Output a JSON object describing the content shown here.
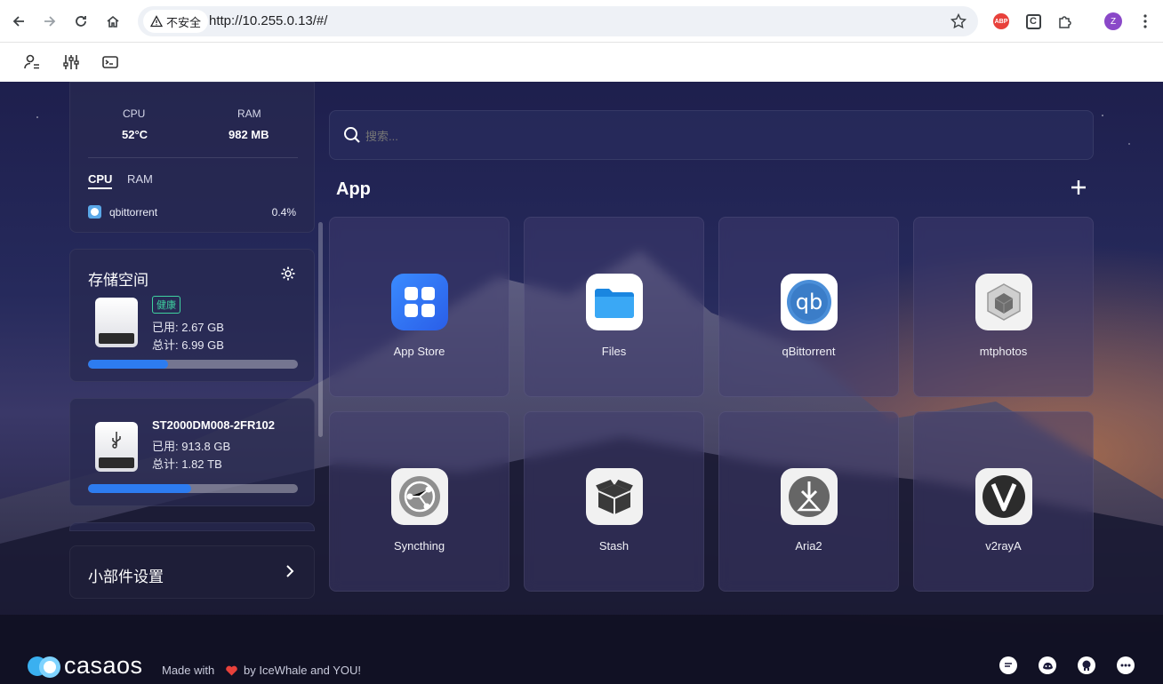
{
  "browser": {
    "security_label": "不安全",
    "url": "http://10.255.0.13/#/",
    "extensions": {
      "abp": "ABP",
      "c": "C"
    },
    "avatar_letter": "Z"
  },
  "sidebar": {
    "system": {
      "cpu_label": "CPU",
      "cpu_value": "52°C",
      "ram_label": "RAM",
      "ram_value": "982 MB",
      "tabs": [
        "CPU",
        "RAM"
      ],
      "process_name": "qbittorrent",
      "process_usage": "0.4%"
    },
    "storage": {
      "title": "存储空间",
      "drives": [
        {
          "badge": "健康",
          "used": "已用: 2.67 GB",
          "total": "总计: 6.99 GB",
          "usage_fraction": 0.38
        },
        {
          "name": "ST2000DM008-2FR102",
          "used": "已用: 913.8 GB",
          "total": "总计: 1.82 TB",
          "usage_fraction": 0.49
        }
      ]
    },
    "widget_settings": "小部件设置"
  },
  "main": {
    "search_placeholder": "搜索...",
    "section_title": "App",
    "apps": [
      {
        "name": "App Store",
        "icon": "app-store-icon"
      },
      {
        "name": "Files",
        "icon": "folder-icon"
      },
      {
        "name": "qBittorrent",
        "icon": "qbittorrent-icon"
      },
      {
        "name": "mtphotos",
        "icon": "cube-icon"
      },
      {
        "name": "Syncthing",
        "icon": "syncthing-icon"
      },
      {
        "name": "Stash",
        "icon": "box-icon"
      },
      {
        "name": "Aria2",
        "icon": "aria2-icon"
      },
      {
        "name": "v2rayA",
        "icon": "v2raya-icon"
      }
    ]
  },
  "footer": {
    "logo": "casaos",
    "made_with": "Made with",
    "by_text": "by IceWhale and YOU!"
  },
  "colors": {
    "accent": "#2d7cf0",
    "healthy": "#3fd2a0",
    "heart": "#e8413b"
  }
}
